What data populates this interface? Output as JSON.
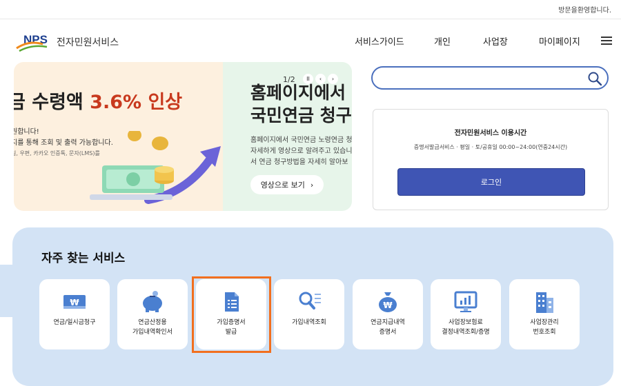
{
  "topbar": {
    "welcome": "방문을환영합니다."
  },
  "header": {
    "logo_mark": "NPS",
    "logo_text": "전자민원서비스",
    "nav": [
      {
        "label": "서비스가이드"
      },
      {
        "label": "개인"
      },
      {
        "label": "사업장"
      },
      {
        "label": "마이페이지"
      }
    ]
  },
  "banner": {
    "slide1": {
      "title_prefix": "금 수령액 ",
      "title_highlight": "3.6% 인상",
      "line1": "원합니다!",
      "line2": "지를 통해 조회 및 출력 가능합니다.",
      "line3": "일, 우편, 카카오 인증톡, 문자(LMS)를"
    },
    "slide2": {
      "title_line1": "홈페이지에서",
      "title_line2": "국민연금 청구",
      "desc_line1": "홈페이지에서 국민연금 노령연금 청",
      "desc_line2": "자세하게 영상으로 알려주고 있습니",
      "desc_line3": "서 연금 청구방법을 자세히 알아보",
      "button": "영상으로 보기"
    },
    "pager": "1/2",
    "controls": {
      "pause": "II",
      "prev": "‹",
      "next": "›"
    }
  },
  "search": {
    "value": "",
    "placeholder": ""
  },
  "service_box": {
    "title": "전자민원서비스 이용시간",
    "hours": "증명서발급서비스 · 평일 · 토/공휴일 00:00~24:00(연중24시간)",
    "login": "로그인"
  },
  "frequent": {
    "title": "자주 찾는 서비스",
    "items": [
      {
        "label": "연금/일시금청구",
        "icon": "won-card-icon"
      },
      {
        "label": "연금산정용\n가입내역확인서",
        "icon": "piggy-bank-icon"
      },
      {
        "label": "가입증명서\n발급",
        "icon": "document-icon"
      },
      {
        "label": "가입내역조회",
        "icon": "search-list-icon"
      },
      {
        "label": "연금지급내역\n증명서",
        "icon": "money-bag-icon"
      },
      {
        "label": "사업장보험료\n결정내역조회/증명",
        "icon": "monitor-chart-icon"
      },
      {
        "label": "사업장관리\n번호조회",
        "icon": "building-icon"
      }
    ]
  },
  "colors": {
    "accent_blue": "#3f55b4",
    "highlight_red": "#c8391e",
    "section_bg": "#d3e3f5",
    "selection_outline": "#f26f1e",
    "icon_blue": "#4a7fd0"
  }
}
